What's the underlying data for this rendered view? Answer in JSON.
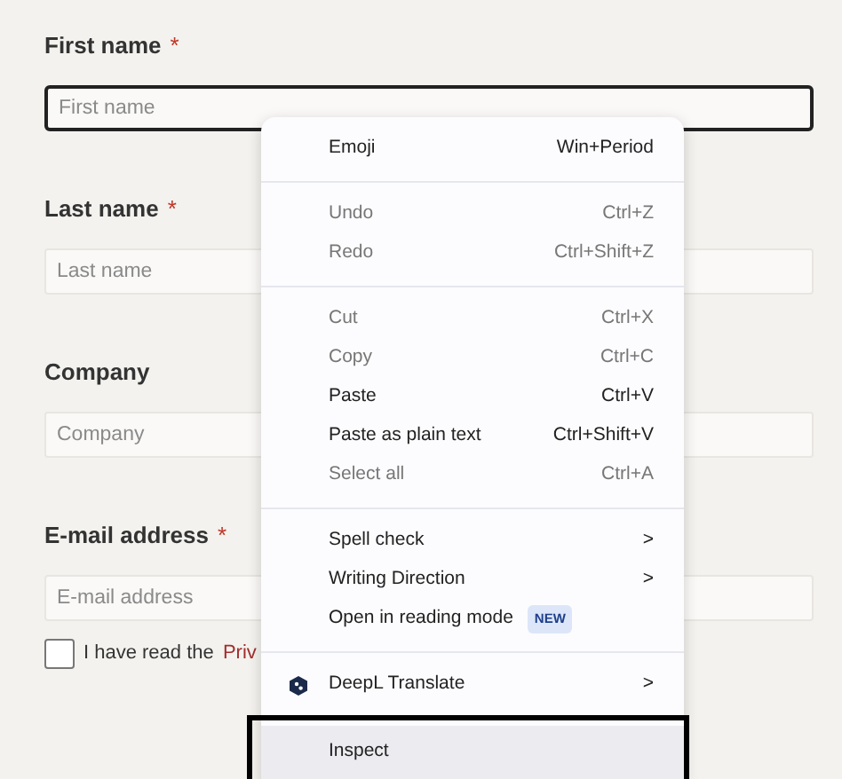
{
  "form": {
    "fields": [
      {
        "label": "First name",
        "required_mark": "*",
        "placeholder": "First name",
        "focused": true
      },
      {
        "label": "Last name",
        "required_mark": "*",
        "placeholder": "Last name",
        "focused": false
      },
      {
        "label": "Company",
        "placeholder": "Company",
        "focused": false
      },
      {
        "label": "E-mail address",
        "required_mark": "*",
        "placeholder": "E-mail address",
        "focused": false
      }
    ],
    "consent": {
      "checked": false,
      "text": "I have read the",
      "link": "Priv"
    }
  },
  "context_menu": {
    "groups": [
      {
        "items": [
          {
            "kind": "shortcut",
            "label": "Emoji",
            "shortcut": "Win+Period",
            "disabled": false,
            "selected": false
          }
        ]
      },
      {
        "items": [
          {
            "kind": "shortcut",
            "label": "Undo",
            "shortcut": "Ctrl+Z",
            "disabled": true,
            "selected": false
          },
          {
            "kind": "shortcut",
            "label": "Redo",
            "shortcut": "Ctrl+Shift+Z",
            "disabled": true,
            "selected": false
          }
        ]
      },
      {
        "items": [
          {
            "kind": "shortcut",
            "label": "Cut",
            "shortcut": "Ctrl+X",
            "disabled": true,
            "selected": false
          },
          {
            "kind": "shortcut",
            "label": "Copy",
            "shortcut": "Ctrl+C",
            "disabled": true,
            "selected": false
          },
          {
            "kind": "shortcut",
            "label": "Paste",
            "shortcut": "Ctrl+V",
            "disabled": false,
            "selected": false
          },
          {
            "kind": "shortcut",
            "label": "Paste as plain text",
            "shortcut": "Ctrl+Shift+V",
            "disabled": false,
            "selected": false
          },
          {
            "kind": "shortcut",
            "label": "Select all",
            "shortcut": "Ctrl+A",
            "disabled": true,
            "selected": false
          }
        ]
      },
      {
        "items": [
          {
            "kind": "submenu",
            "label": "Spell check",
            "arrow": ">",
            "disabled": false,
            "selected": false
          },
          {
            "kind": "submenu",
            "label": "Writing Direction",
            "arrow": ">",
            "disabled": false,
            "selected": false
          },
          {
            "kind": "badge",
            "label": "Open in reading mode",
            "badge": "NEW",
            "disabled": false,
            "selected": false
          }
        ]
      },
      {
        "items": [
          {
            "kind": "extension",
            "label": "DeepL Translate",
            "arrow": ">",
            "disabled": false,
            "selected": false
          }
        ]
      },
      {
        "items": [
          {
            "kind": "plain",
            "label": "Inspect",
            "disabled": false,
            "selected": true,
            "framed": true
          }
        ]
      }
    ]
  }
}
